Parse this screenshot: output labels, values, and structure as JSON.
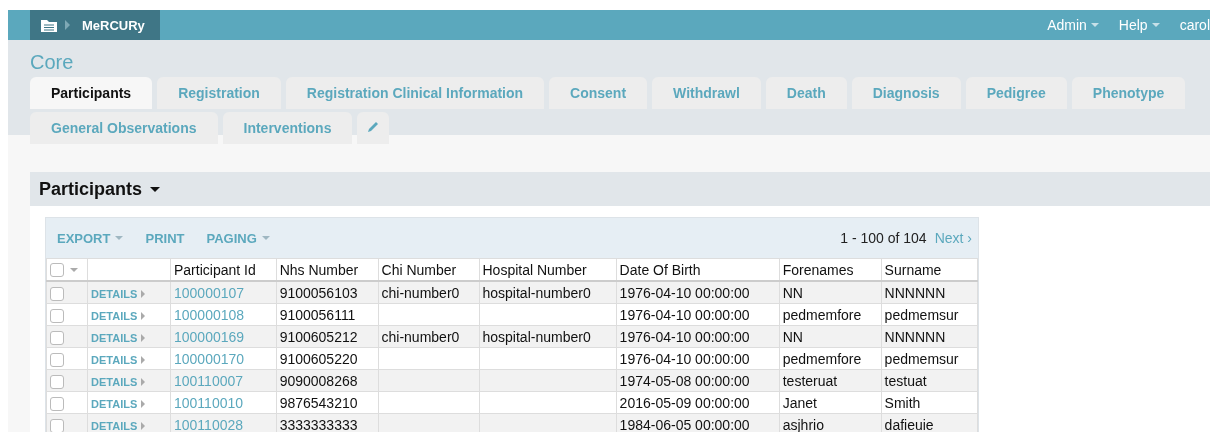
{
  "header": {
    "app_name": "MeRCURy",
    "menus": [
      {
        "label": "Admin",
        "dropdown": true
      },
      {
        "label": "Help",
        "dropdown": true
      },
      {
        "label": "carol",
        "dropdown": false
      }
    ]
  },
  "section_title": "Core",
  "tab_rows": [
    [
      {
        "kind": "text",
        "label": "Participants",
        "selected": true
      },
      {
        "kind": "text",
        "label": "Registration",
        "selected": false
      },
      {
        "kind": "text",
        "label": "Registration Clinical Information",
        "selected": false
      },
      {
        "kind": "text",
        "label": "Consent",
        "selected": false
      },
      {
        "kind": "text",
        "label": "Withdrawl",
        "selected": false
      },
      {
        "kind": "text",
        "label": "Death",
        "selected": false
      },
      {
        "kind": "text",
        "label": "Diagnosis",
        "selected": false
      },
      {
        "kind": "text",
        "label": "Pedigree",
        "selected": false
      },
      {
        "kind": "text",
        "label": "Phenotype",
        "selected": false
      }
    ],
    [
      {
        "kind": "text",
        "label": "General Observations",
        "selected": false
      },
      {
        "kind": "text",
        "label": "Interventions",
        "selected": false
      },
      {
        "kind": "icon",
        "selected": false
      }
    ]
  ],
  "panel": {
    "title": "Participants",
    "toolbar": [
      {
        "label": "EXPORT",
        "dropdown": true
      },
      {
        "label": "PRINT",
        "dropdown": false
      },
      {
        "label": "PAGING",
        "dropdown": true
      }
    ],
    "range": "1 - 100 of 104",
    "next": "Next ›",
    "select_all": {
      "checked": false
    },
    "columns": [
      {
        "label": "Participant Id",
        "kind": "link"
      },
      {
        "label": "Nhs Number",
        "kind": "text"
      },
      {
        "label": "Chi Number",
        "kind": "text"
      },
      {
        "label": "Hospital Number",
        "kind": "text"
      },
      {
        "label": "Date Of Birth",
        "kind": "text"
      },
      {
        "label": "Forenames",
        "kind": "text"
      },
      {
        "label": "Surname",
        "kind": "text"
      }
    ],
    "rows": [
      {
        "checked": false,
        "action": "DETAILS",
        "cells": [
          "100000107",
          "9100056103",
          "chi-number0",
          "hospital-number0",
          "1976-04-10 00:00:00",
          "NN",
          "NNNNNN"
        ]
      },
      {
        "checked": false,
        "action": "DETAILS",
        "cells": [
          "100000108",
          "9100056111",
          null,
          null,
          "1976-04-10 00:00:00",
          "pedmemfore",
          "pedmemsur"
        ]
      },
      {
        "checked": false,
        "action": "DETAILS",
        "cells": [
          "100000169",
          "9100605212",
          "chi-number0",
          "hospital-number0",
          "1976-04-10 00:00:00",
          "NN",
          "NNNNNN"
        ]
      },
      {
        "checked": false,
        "action": "DETAILS",
        "cells": [
          "100000170",
          "9100605220",
          null,
          null,
          "1976-04-10 00:00:00",
          "pedmemfore",
          "pedmemsur"
        ]
      },
      {
        "checked": false,
        "action": "DETAILS",
        "cells": [
          "100110007",
          "9090008268",
          null,
          null,
          "1974-05-08 00:00:00",
          "testeruat",
          "testuat"
        ]
      },
      {
        "checked": false,
        "action": "DETAILS",
        "cells": [
          "100110010",
          "9876543210",
          null,
          null,
          "2016-05-09 00:00:00",
          "Janet",
          "Smith"
        ]
      },
      {
        "checked": false,
        "action": "DETAILS",
        "cells": [
          "100110028",
          "3333333333",
          null,
          null,
          "1984-06-05 00:00:00",
          "asjhrio",
          "dafieuie"
        ]
      }
    ]
  }
}
